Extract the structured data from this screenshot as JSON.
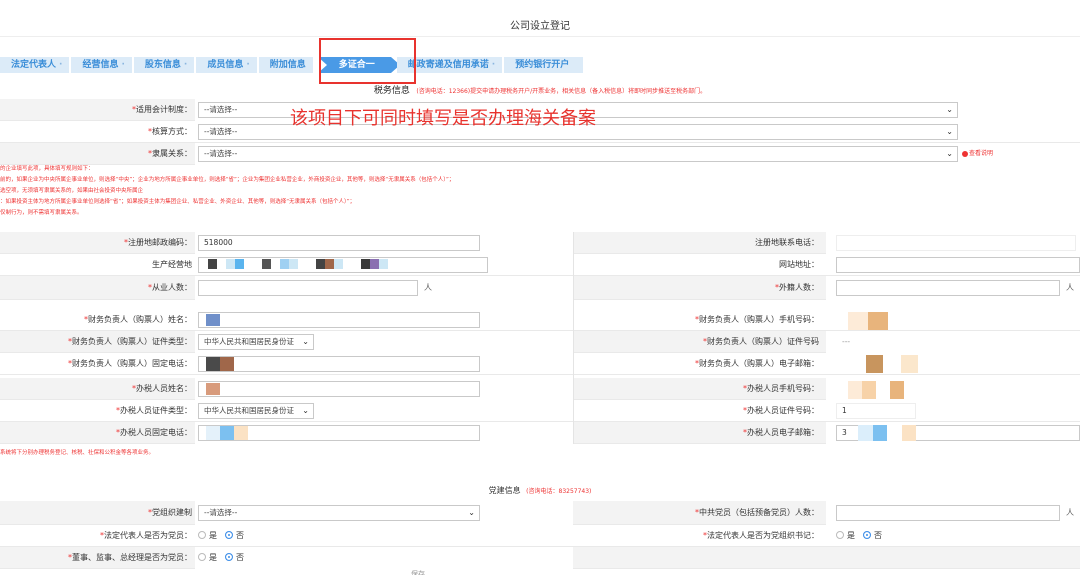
{
  "page": {
    "title": "公司设立登记"
  },
  "steps": [
    {
      "label": "法定代表人"
    },
    {
      "label": "经营信息"
    },
    {
      "label": "股东信息"
    },
    {
      "label": "成员信息"
    },
    {
      "label": "附加信息"
    },
    {
      "label": "多证合一"
    },
    {
      "label": "邮政寄递及信用承诺"
    },
    {
      "label": "预约银行开户"
    }
  ],
  "step_separator": "·",
  "tax_section": {
    "title": "税务信息",
    "hint": "(咨询电话：12366)提交申请办理税务开户/开票业务，相关信息（备入税信息）将即时同步推送至税务部门。"
  },
  "annotation": "该项目下可同时填写是否办理海关备案",
  "tax_fields": {
    "accounting": {
      "label": "适用会计制度：",
      "value": "--请选择--"
    },
    "method": {
      "label": "核算方式：",
      "value": "--请选择--"
    },
    "affiliation": {
      "label": "隶属关系：",
      "value": "--请选择--",
      "link": "查看说明"
    }
  },
  "notes": [
    "的企业填写此项，具体填写规则如下：",
    "前的，如果企业为中央所属企事业单位，则选择“中央”；企业为地方所属企事业单位，则选择“省”；企业为集团企业私营企业，外商投资企业，其他等，则选择“无隶属关系（包括个人）”；",
    "选空项，无须填写隶属关系的，如果由社会投资中央所属企",
    "：如果投资主体为地方所属企事业单位则选择“省”；如果投资主体为集团企业、私营企业、外资企业、其他等，则选择“无隶属关系（包括个人）”；",
    "仅制行为，则不需填写隶属关系。"
  ],
  "address": {
    "postcode": {
      "label": "注册地邮政编码：",
      "value": "518000"
    },
    "phone": {
      "label": "注册地联系电话："
    },
    "business_addr": {
      "label": "生产经营地"
    },
    "website": {
      "label": "网站地址："
    },
    "employees": {
      "label": "从业人数：",
      "unit": "人"
    },
    "foreign": {
      "label": "外籍人数：",
      "unit": "人"
    }
  },
  "finance": {
    "name": {
      "label": "财务负责人（购票人）姓名："
    },
    "mobile": {
      "label": "财务负责人（购票人）手机号码："
    },
    "id_type": {
      "label": "财务负责人（购票人）证件类型：",
      "value": "中华人民共和国居民身份证"
    },
    "id_no": {
      "label": "财务负责人（购票人）证件号码",
      "value": "---"
    },
    "tel": {
      "label": "财务负责人（购票人）固定电话："
    },
    "email": {
      "label": "财务负责人（购票人）电子邮箱："
    }
  },
  "tax_agent": {
    "name": {
      "label": "办税人员姓名："
    },
    "mobile": {
      "label": "办税人员手机号码："
    },
    "id_type": {
      "label": "办税人员证件类型：",
      "value": "中华人民共和国居民身份证"
    },
    "id_no": {
      "label": "办税人员证件号码：",
      "value": "1"
    },
    "tel": {
      "label": "办税人员固定电话："
    },
    "email": {
      "label": "办税人员电子邮箱：",
      "value": "3"
    }
  },
  "warning": "系统将下分别办理税务登记、核税、社保和公积金等各项业务。",
  "party": {
    "title": "党建信息",
    "hint": "(咨询电话：83257743)",
    "org": {
      "label": "党组织建制",
      "value": "--请选择--"
    },
    "members": {
      "label": "中共党员（包括预备党员）人数：",
      "unit": "人"
    },
    "legal_is_member": {
      "label": "法定代表人是否为党员："
    },
    "legal_is_secretary": {
      "label": "法定代表人是否为党组织书记："
    },
    "exec_is_member": {
      "label": "董事、监事、总经理是否为党员："
    },
    "yes": "是",
    "no": "否"
  },
  "bottom_fragment": "保存",
  "colors": {
    "accent": "#4a9ae6",
    "required": "#e33333",
    "highlight": "#e8332e"
  }
}
